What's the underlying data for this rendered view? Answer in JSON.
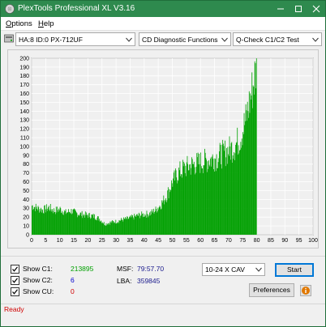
{
  "window": {
    "title": "PlexTools Professional XL V3.16"
  },
  "menu": {
    "items": [
      {
        "accel": "O",
        "rest": "ptions"
      },
      {
        "accel": "H",
        "rest": "elp"
      }
    ]
  },
  "toolbar": {
    "drive": "HA:8 ID:0  PX-712UF",
    "function": "CD Diagnostic Functions",
    "test": "Q-Check C1/C2 Test"
  },
  "chart_data": {
    "type": "bar",
    "x_ticks": [
      0,
      5,
      10,
      15,
      20,
      25,
      30,
      35,
      40,
      45,
      50,
      55,
      60,
      65,
      70,
      75,
      80,
      85,
      90,
      95,
      100
    ],
    "y_ticks": [
      0,
      10,
      20,
      30,
      40,
      50,
      60,
      70,
      80,
      90,
      100,
      110,
      120,
      130,
      140,
      150,
      160,
      170,
      180,
      190,
      200
    ],
    "xlim": [
      0,
      100
    ],
    "ylim": [
      0,
      200
    ],
    "grid": true,
    "series": [
      {
        "color": "#00a000",
        "x": [
          0,
          2,
          4,
          6,
          8,
          10,
          12,
          14,
          16,
          18,
          20,
          22,
          24,
          26,
          28,
          30,
          32,
          34,
          36,
          38,
          40,
          42,
          44,
          46,
          48,
          50,
          52,
          54,
          56,
          58,
          60,
          62,
          64,
          66,
          68,
          70,
          72,
          74,
          76,
          78,
          79.9
        ],
        "y": [
          33,
          30,
          28,
          31,
          27,
          29,
          25,
          27,
          24,
          23,
          22,
          21,
          18,
          12,
          14,
          15,
          17,
          18,
          20,
          22,
          23,
          24,
          28,
          35,
          45,
          60,
          70,
          75,
          78,
          80,
          82,
          84,
          86,
          88,
          92,
          96,
          100,
          110,
          130,
          160,
          190
        ]
      }
    ]
  },
  "stats": {
    "c1_label": "Show C1:",
    "c1_value": "213895",
    "c2_label": "Show C2:",
    "c2_value": "6",
    "cu_label": "Show CU:",
    "cu_value": "0",
    "msf_label": "MSF:",
    "msf_value": "79:57.70",
    "lba_label": "LBA:",
    "lba_value": "359845"
  },
  "controls": {
    "speed": "10-24 X CAV",
    "start_label": "Start",
    "preferences_label": "Preferences"
  },
  "status": {
    "text": "Ready"
  },
  "colors": {
    "titlebar": "#2e8a4e",
    "plot_bg": "#f0f0f0",
    "bar": "#00a000",
    "status": "#d00000",
    "value_text": "#1a1a8c"
  }
}
